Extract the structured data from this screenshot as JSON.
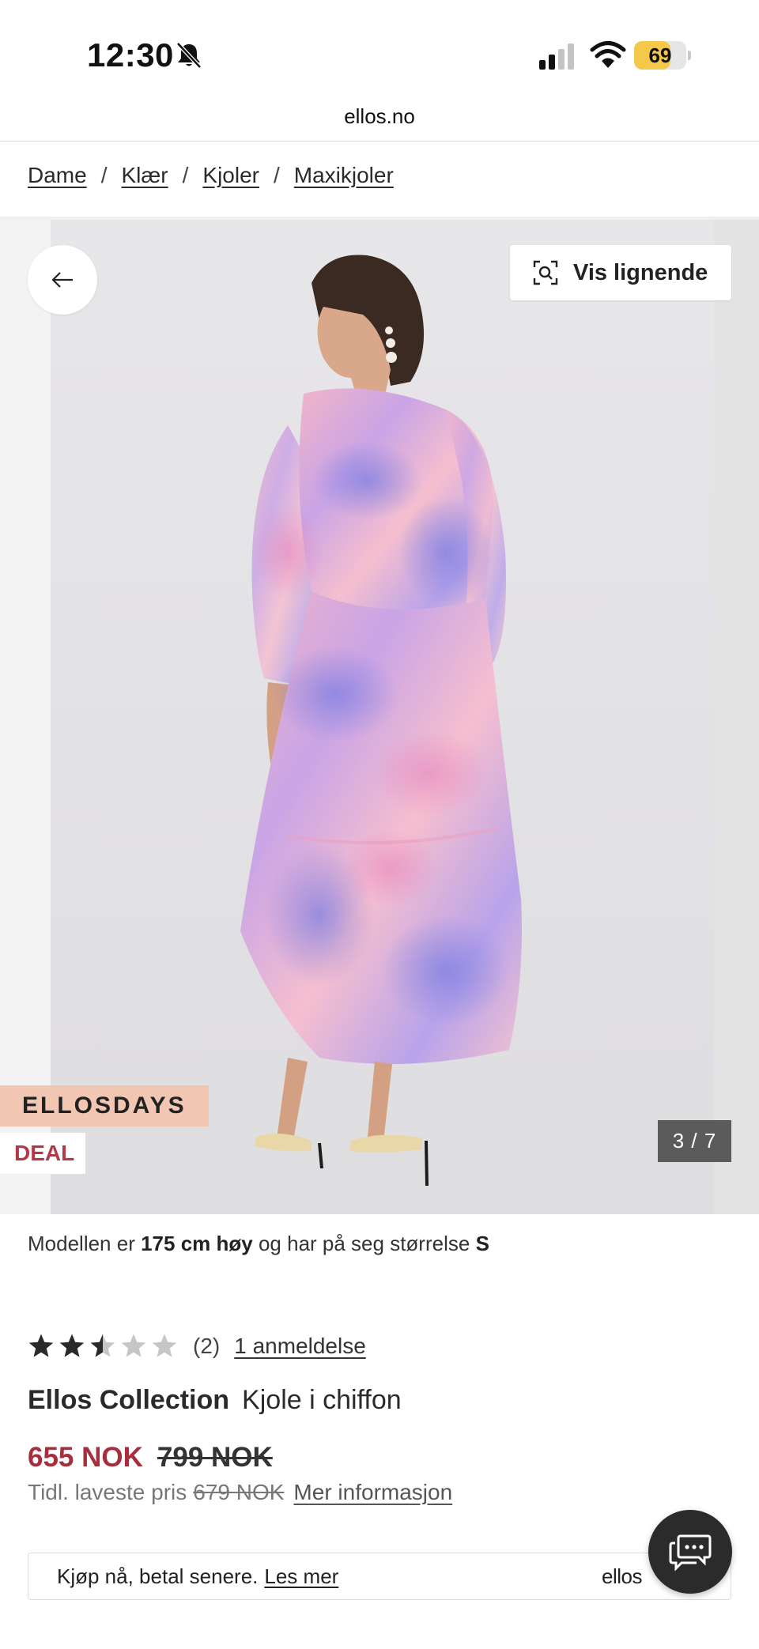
{
  "status_bar": {
    "time": "12:30",
    "battery_level": "69",
    "battery_fraction": 0.69,
    "icons": [
      "bell-slash-icon",
      "cellular-signal-icon",
      "wifi-icon",
      "battery-icon"
    ]
  },
  "browser": {
    "url": "ellos.no"
  },
  "breadcrumb": [
    {
      "label": "Dame"
    },
    {
      "label": "Klær"
    },
    {
      "label": "Kjoler"
    },
    {
      "label": "Maxikjoler"
    }
  ],
  "breadcrumb_separator": "/",
  "gallery": {
    "back_icon": "arrow-left-icon",
    "similar_icon": "visual-search-icon",
    "similar_label": "Vis lignende",
    "badge_campaign": "ELLOSDAYS",
    "badge_deal": "DEAL",
    "counter": "3 / 7",
    "current_image": 3,
    "total_images": 7
  },
  "model_info": {
    "prefix": "Modellen er",
    "height": "175 cm høy",
    "middle": "og har på seg størrelse",
    "size": "S"
  },
  "rating": {
    "value": 2.5,
    "max": 5,
    "count": "(2)",
    "reviews_link": "1 anmeldelse"
  },
  "product": {
    "brand": "Ellos Collection",
    "name": "Kjole i chiffon"
  },
  "price": {
    "sale": "655 NOK",
    "original": "799 NOK",
    "lowest_label": "Tidl. laveste pris",
    "lowest_value": "679 NOK",
    "info_link": "Mer informasjon"
  },
  "bnpl": {
    "text": "Kjøp nå, betal senere.",
    "link": "Les mer",
    "logo": "ellos"
  },
  "chat": {
    "icon": "chat-bubble-icon"
  },
  "colors": {
    "sale_red": "#a72e3d",
    "deal_red": "#b23a48",
    "campaign_peach": "#f1c7b4",
    "battery_yellow": "#f5c84a",
    "chat_dark": "#2b2b2b"
  }
}
